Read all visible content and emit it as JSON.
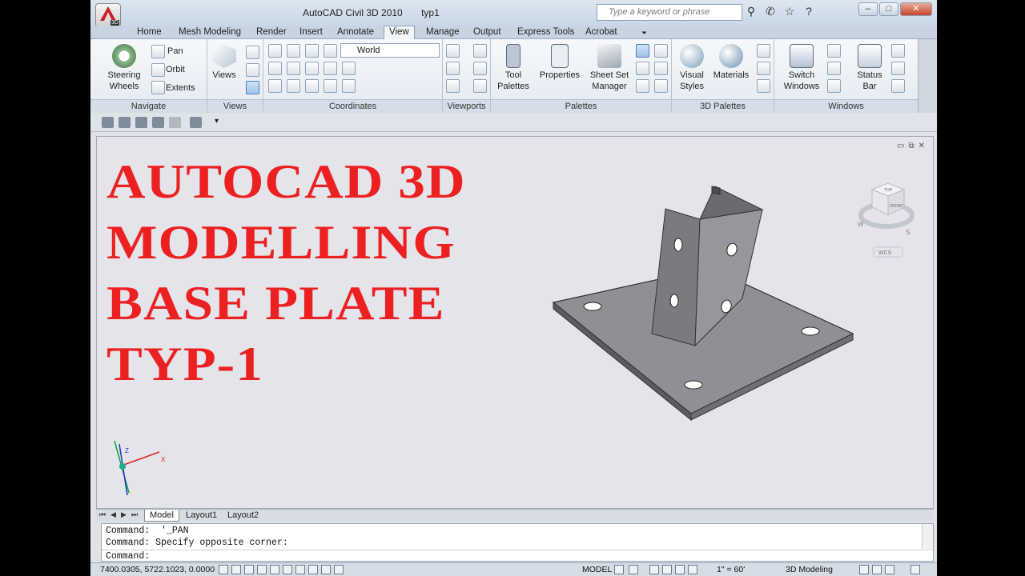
{
  "app": {
    "product_tag": "3D",
    "title": "AutoCAD Civil 3D 2010",
    "file": "typ1"
  },
  "search": {
    "placeholder": "Type a keyword or phrase"
  },
  "window_controls": {
    "min": "–",
    "max": "□",
    "close": "✕"
  },
  "tabs": [
    "Home",
    "Mesh Modeling",
    "Render",
    "Insert",
    "Annotate",
    "View",
    "Manage",
    "Output",
    "Express Tools",
    "Acrobat"
  ],
  "active_tab": "View",
  "ribbon": {
    "navigate": {
      "title": "Navigate",
      "steering_line1": "Steering",
      "steering_line2": "Wheels",
      "pan": "Pan",
      "orbit": "Orbit",
      "extents": "Extents"
    },
    "views": {
      "title": "Views",
      "button": "Views"
    },
    "coordinates": {
      "title": "Coordinates",
      "ucs": "World"
    },
    "viewports": {
      "title": "Viewports"
    },
    "palettes": {
      "title": "Palettes",
      "tool_line1": "Tool",
      "tool_line2": "Palettes",
      "properties": "Properties",
      "sheet_line1": "Sheet Set",
      "sheet_line2": "Manager"
    },
    "palettes3d": {
      "title": "3D Palettes",
      "visual_line1": "Visual",
      "visual_line2": "Styles",
      "materials": "Materials"
    },
    "windows": {
      "title": "Windows",
      "switch_line1": "Switch",
      "switch_line2": "Windows",
      "status_line1": "Status",
      "status_line2": "Bar"
    }
  },
  "drawing": {
    "title_lines": [
      "AUTOCAD 3D",
      "MODELLING",
      "BASE PLATE",
      "TYP-1"
    ],
    "viewcube": {
      "top": "TOP",
      "front": "FRONT",
      "w": "W",
      "s": "S",
      "wcs": "WCS"
    },
    "ucs_axes": {
      "x": "X",
      "z": "Z"
    }
  },
  "layout_tabs": [
    "Model",
    "Layout1",
    "Layout2"
  ],
  "command": {
    "line1": "Command:  '_PAN",
    "line2": "Command: Specify opposite corner:",
    "prompt": "Command:"
  },
  "status": {
    "coords": "7400.0305, 5722.1023, 0.0000",
    "model": "MODEL",
    "scale": "1\" = 60'",
    "workspace": "3D Modeling"
  }
}
